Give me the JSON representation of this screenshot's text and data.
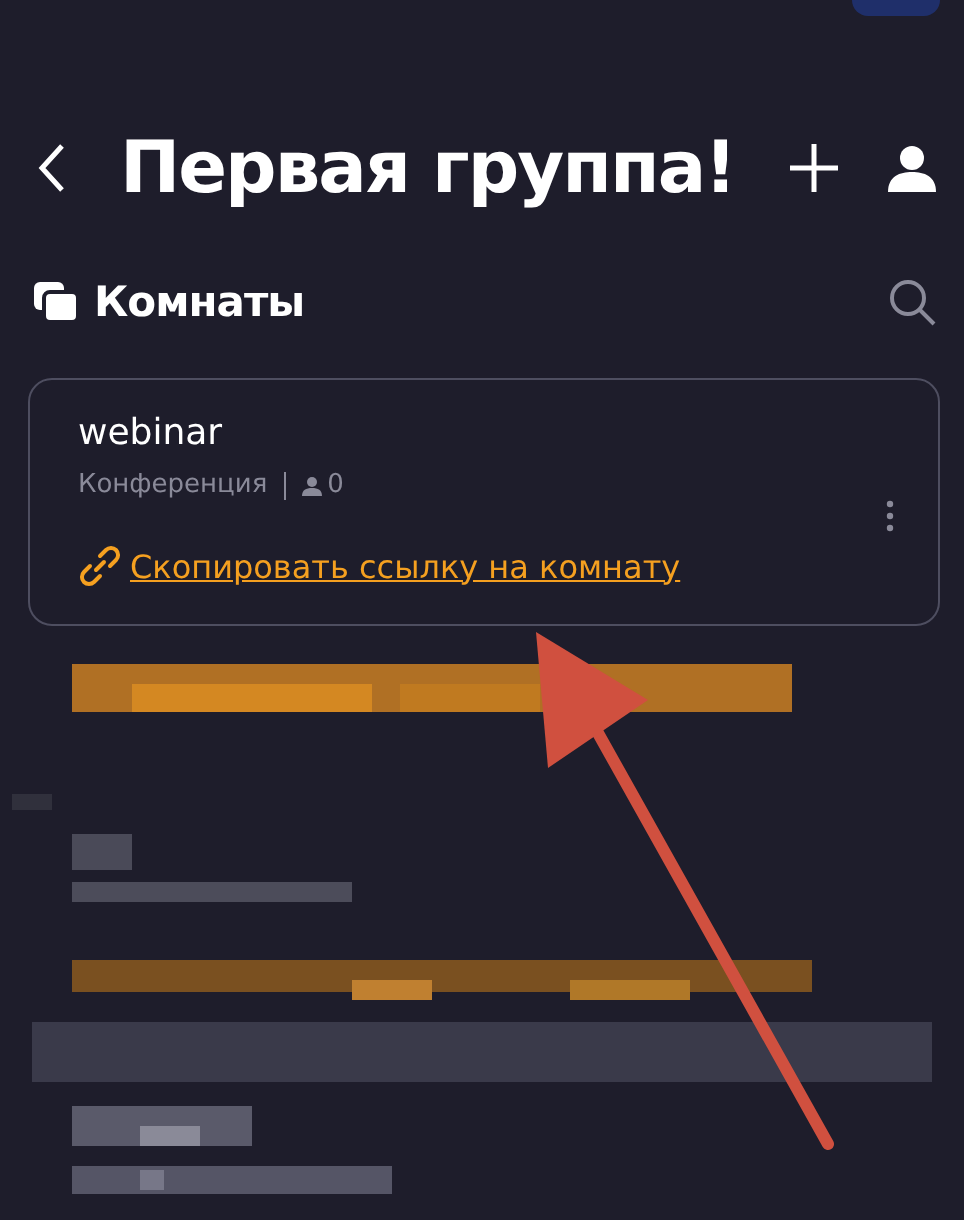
{
  "header": {
    "title": "Первая группа!"
  },
  "section": {
    "label": "Комнаты"
  },
  "rooms": [
    {
      "name": "webinar",
      "type": "Конференция",
      "participants": "0",
      "link": "Скопировать ссылку на комнату"
    }
  ]
}
